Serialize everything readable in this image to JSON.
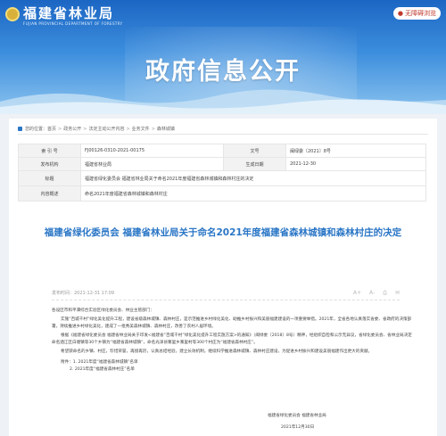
{
  "header": {
    "org_name_cn": "福建省林业局",
    "org_name_en": "FUJIAN PROVINCIAL DEPARTMENT OF FORESTRY",
    "top_button_label": "无障碍浏览",
    "banner_title": "政府信息公开"
  },
  "breadcrumb": [
    "首页",
    "政务公开",
    "法定主动公开内容",
    "业务文件",
    "森林城镇"
  ],
  "meta": {
    "rows": [
      {
        "label": "索 引 号",
        "value": "FJ00126-0310-2021-00175",
        "label2": "文号",
        "value2": "闽绿委〔2021〕8号"
      },
      {
        "label": "发布机构",
        "value": "福建省林业局",
        "label2": "生成日期",
        "value2": "2021-12-30"
      },
      {
        "label": "标题",
        "value": "福建省绿化委员会 福建省林业局关于命名2021年度福建省森林城镇和森林村庄的决定"
      },
      {
        "label": "内容概述",
        "value": "命名2021年度福建省森林城镇和森林村庄"
      }
    ]
  },
  "article": {
    "title": "福建省绿化委员会 福建省林业局关于命名2021年度福建省森林城镇和森林村庄的决定",
    "published": "发布时间：2021-12-31 17:09",
    "font_tools": [
      "A+",
      "A-",
      "打印",
      "分享"
    ],
    "salutation": "各设区市和平潭综合实验区绿化委员会、林业主管部门：",
    "paragraphs": [
      "实施“百城千村”绿化美化提升工程，建设省级森林城镇、森林村庄，是示范推进乡村绿化美化、助推乡村振兴和美丽福建建设的一项重要举措。2021年，全省各地认真落实省委、省政府的决策部署，持续推进乡村绿化美化，建成了一批秀美森林城镇、森林村庄，改善了农村人居环境。",
      "根据《福建省绿化委员会 福建省林业局关于印发<福建省“百城千村”绿化美化提升工程实施方案>的通知》（闽绿委〔2018〕8号）精神，经组织自检和公示无异议，省绿化委员会、省林业局决定命名涵江区白塘镇等30个乡镇为“福建省森林城镇”，命名光泽县寨里乡寨里村等300个村庄为“福建省森林村庄”。",
      "希望获命名的乡镇、村庄，珍惜荣誉，再接再厉，认真总结经验，建立长效机制，继续科学推进森林城镇、森林村庄建设，为促进乡村振兴和建设美丽福建作出更大的贡献。"
    ],
    "attachments_label": "附件：1. 2021年度“福建省森林城镇”名单",
    "attachment_2": "2. 2021年度“福建省森林村庄”名单",
    "signature_orgs": "福建省绿化委员会  福建省林业局",
    "signature_date": "2021年12月30日"
  }
}
